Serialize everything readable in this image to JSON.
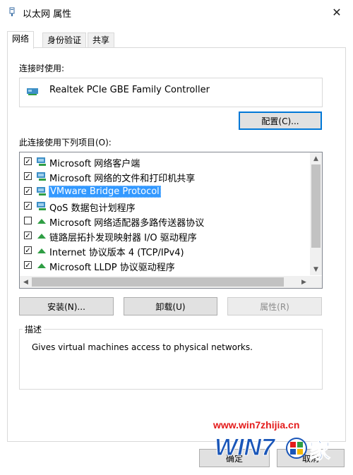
{
  "window": {
    "title": "以太网 属性"
  },
  "tabs": [
    {
      "label": "网络"
    },
    {
      "label": "身份验证"
    },
    {
      "label": "共享"
    }
  ],
  "connect_using": {
    "label": "连接时使用:",
    "adapter": "Realtek PCIe GBE Family Controller",
    "configure_button": "配置(C)..."
  },
  "components": {
    "label": "此连接使用下列项目(O):",
    "items": [
      {
        "text": "Microsoft 网络客户端",
        "checked": true
      },
      {
        "text": "Microsoft 网络的文件和打印机共享",
        "checked": true
      },
      {
        "text": "VMware Bridge Protocol",
        "checked": true,
        "selected": true
      },
      {
        "text": "QoS 数据包计划程序",
        "checked": true
      },
      {
        "text": "Microsoft 网络适配器多路传送器协议",
        "checked": false
      },
      {
        "text": "链路层拓扑发现映射器 I/O 驱动程序",
        "checked": true
      },
      {
        "text": "Internet 协议版本 4 (TCP/IPv4)",
        "checked": true
      },
      {
        "text": "Microsoft LLDP 协议驱动程序",
        "checked": true
      }
    ]
  },
  "actions": {
    "install": "安装(N)...",
    "uninstall": "卸载(U)",
    "properties": "属性(R)"
  },
  "description": {
    "legend": "描述",
    "text": "Gives virtual machines access to physical networks."
  },
  "footer": {
    "ok": "确定",
    "cancel": "取消"
  },
  "watermark": {
    "url": "www.win7zhijia.cn",
    "logo_text": "WIN7之家"
  },
  "colors": {
    "selection": "#3399ff",
    "primary_border": "#0078d7",
    "watermark_red": "#e41b1b",
    "watermark_blue": "#1a56b8"
  }
}
